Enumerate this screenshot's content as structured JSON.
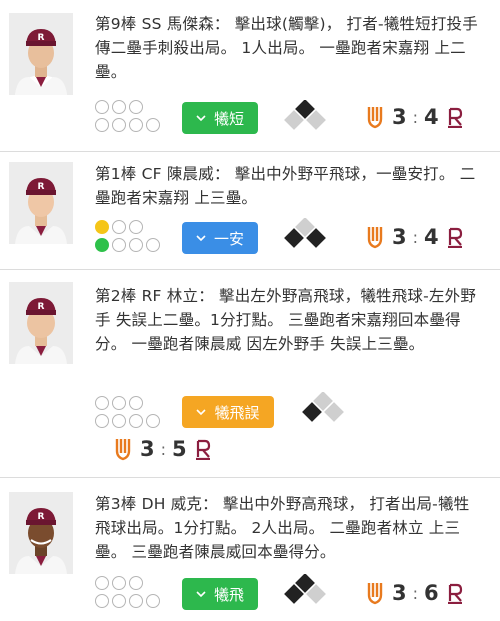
{
  "plays": [
    {
      "text": "第9棒 SS 馬傑森： 擊出球(觸擊)， 打者-犧牲短打投手 傳二壘手刺殺出局。 1人出局。 一壘跑者宋嘉翔 上二壘。",
      "badge": "犧短",
      "badge_color": "#2db84d",
      "away_score": "3",
      "home_score": "4",
      "out_lights": "none",
      "count_lights": "none",
      "runners": "second"
    },
    {
      "text": "第1棒 CF 陳晨威： 擊出中外野平飛球，一壘安打。 二壘跑者宋嘉翔 上三壘。",
      "badge": "一安",
      "badge_color": "#3a8ee6",
      "away_score": "3",
      "home_score": "4",
      "out_lights": "1 yellow",
      "count_lights": "1 green",
      "runners": "first, third"
    },
    {
      "text": "第2棒 RF 林立： 擊出左外野高飛球，犧牲飛球-左外野手 失誤上二壘。1分打點。 三壘跑者宋嘉翔回本壘得分。 一壘跑者陳晨威 因左外野手 失誤上三壘。",
      "badge": "犧飛誤",
      "badge_color": "#f5a623",
      "away_score": "3",
      "home_score": "5",
      "out_lights": "none",
      "count_lights": "none",
      "runners": "second, third"
    },
    {
      "text": "第3棒 DH 威克： 擊出中外野高飛球， 打者出局-犧牲飛球出局。1分打點。 2人出局。 二壘跑者林立 上三壘。 三壘跑者陳晨威回本壘得分。",
      "badge": "犧飛",
      "badge_color": "#2db84d",
      "away_score": "3",
      "home_score": "6",
      "out_lights": "none",
      "count_lights": "none",
      "runners": "third"
    }
  ],
  "colors": {
    "away_team": "#e87a1e",
    "home_team": "#8b1e3f",
    "base_filled": "#222222",
    "base_empty": "#cfcfcf"
  },
  "icons": [
    "chevron-down-icon",
    "away-team-logo",
    "home-team-logo",
    "base-diamond-icon"
  ]
}
